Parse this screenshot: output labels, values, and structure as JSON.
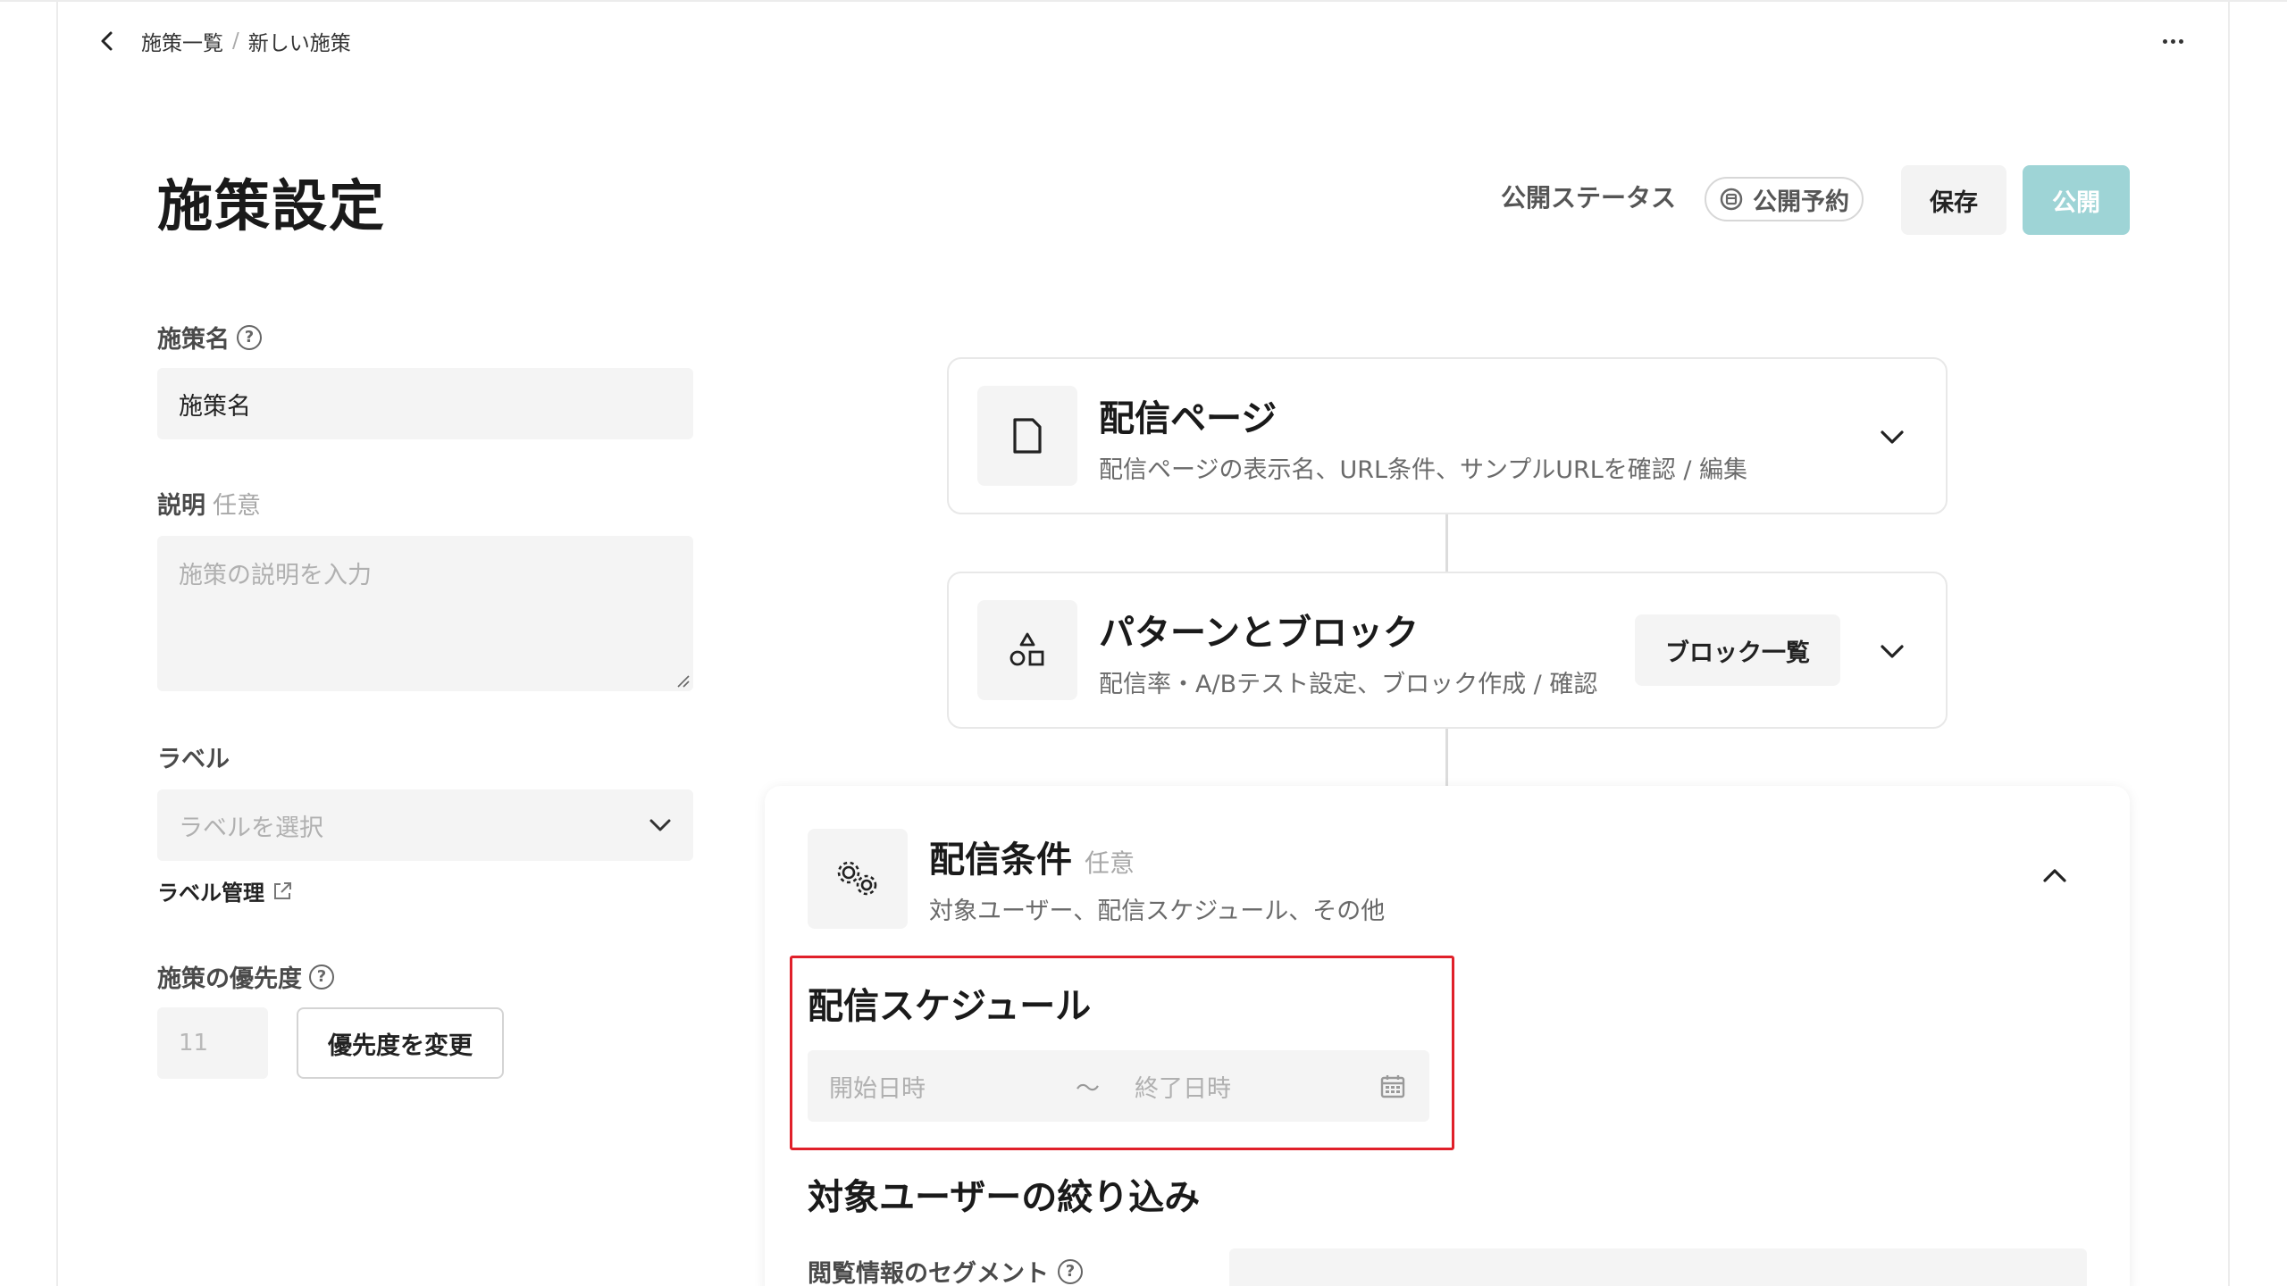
{
  "nav": {
    "breadcrumb_parent": "施策一覧",
    "breadcrumb_sep": "/",
    "breadcrumb_current": "新しい施策"
  },
  "header": {
    "title": "施策設定",
    "status_label": "公開ステータス",
    "status_value": "公開予約",
    "save_label": "保存",
    "publish_label": "公開"
  },
  "form": {
    "name_label": "施策名",
    "name_value": "施策名",
    "desc_label": "説明",
    "desc_optional": "任意",
    "desc_placeholder": "施策の説明を入力",
    "label_label": "ラベル",
    "label_placeholder": "ラベルを選択",
    "label_manage": "ラベル管理",
    "priority_label": "施策の優先度",
    "priority_value": "11",
    "priority_button": "優先度を変更"
  },
  "cards": {
    "page": {
      "title": "配信ページ",
      "desc": "配信ページの表示名、URL条件、サンプルURLを確認 / 編集"
    },
    "pattern": {
      "title": "パターンとブロック",
      "desc": "配信率・A/Bテスト設定、ブロック作成 / 確認",
      "button": "ブロック一覧"
    },
    "condition": {
      "title": "配信条件",
      "optional": "任意",
      "desc": "対象ユーザー、配信スケジュール、その他",
      "schedule_title": "配信スケジュール",
      "start_placeholder": "開始日時",
      "tilde": "〜",
      "end_placeholder": "終了日時",
      "target_title": "対象ユーザーの絞り込み",
      "segment_label": "閲覧情報のセグメント"
    }
  },
  "colors": {
    "accent": "#9ed4d6",
    "highlight": "#e0202a",
    "field_bg": "#f4f4f4"
  },
  "icons": {
    "back": "chevron-left-icon",
    "more": "more-horizontal-icon",
    "help": "question-circle-icon",
    "external": "external-link-icon",
    "page": "document-icon",
    "pattern": "shapes-icon",
    "condition": "gears-icon",
    "calendar": "calendar-icon",
    "status": "scheduled-icon"
  }
}
